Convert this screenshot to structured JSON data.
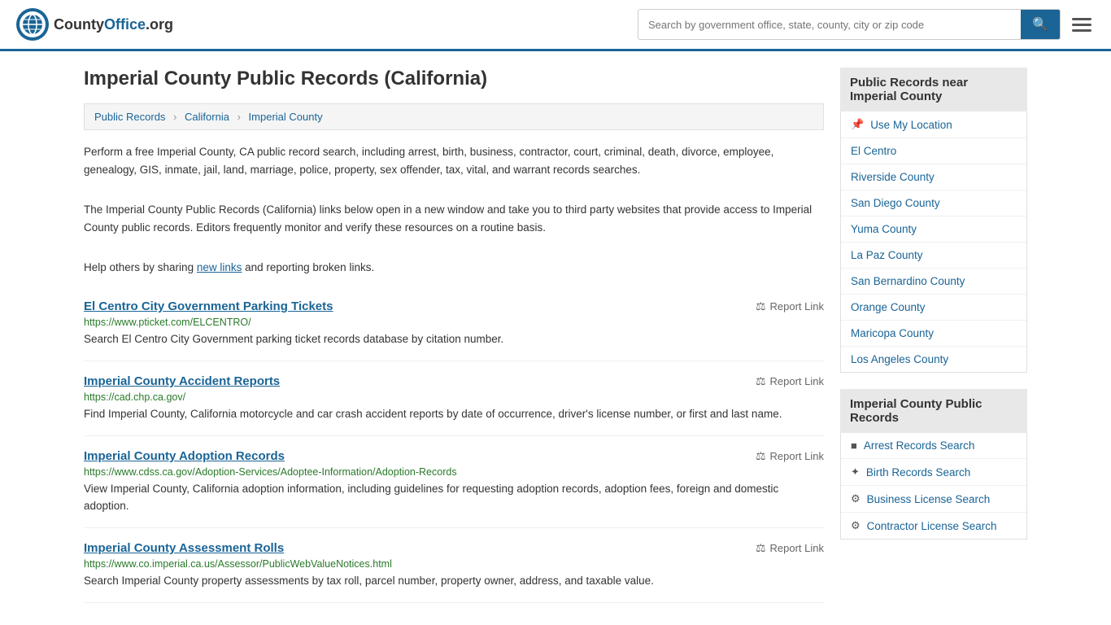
{
  "header": {
    "logo_text": "CountyOffice",
    "logo_suffix": ".org",
    "search_placeholder": "Search by government office, state, county, city or zip code",
    "search_value": ""
  },
  "page": {
    "title": "Imperial County Public Records (California)"
  },
  "breadcrumb": {
    "items": [
      {
        "label": "Public Records",
        "href": "#"
      },
      {
        "label": "California",
        "href": "#"
      },
      {
        "label": "Imperial County",
        "href": "#"
      }
    ]
  },
  "description": {
    "para1": "Perform a free Imperial County, CA public record search, including arrest, birth, business, contractor, court, criminal, death, divorce, employee, genealogy, GIS, inmate, jail, land, marriage, police, property, sex offender, tax, vital, and warrant records searches.",
    "para2": "The Imperial County Public Records (California) links below open in a new window and take you to third party websites that provide access to Imperial County public records. Editors frequently monitor and verify these resources on a routine basis.",
    "para3_pre": "Help others by sharing ",
    "para3_link": "new links",
    "para3_post": " and reporting broken links."
  },
  "records": [
    {
      "title": "El Centro City Government Parking Tickets",
      "url": "https://www.pticket.com/ELCENTRO/",
      "desc": "Search El Centro City Government parking ticket records database by citation number.",
      "report": "Report Link"
    },
    {
      "title": "Imperial County Accident Reports",
      "url": "https://cad.chp.ca.gov/",
      "desc": "Find Imperial County, California motorcycle and car crash accident reports by date of occurrence, driver's license number, or first and last name.",
      "report": "Report Link"
    },
    {
      "title": "Imperial County Adoption Records",
      "url": "https://www.cdss.ca.gov/Adoption-Services/Adoptee-Information/Adoption-Records",
      "desc": "View Imperial County, California adoption information, including guidelines for requesting adoption records, adoption fees, foreign and domestic adoption.",
      "report": "Report Link"
    },
    {
      "title": "Imperial County Assessment Rolls",
      "url": "https://www.co.imperial.ca.us/Assessor/PublicWebValueNotices.html",
      "desc": "Search Imperial County property assessments by tax roll, parcel number, property owner, address, and taxable value.",
      "report": "Report Link"
    }
  ],
  "sidebar": {
    "nearby_section": {
      "title": "Public Records near Imperial County",
      "items": [
        {
          "label": "Use My Location",
          "icon": "pin",
          "href": "#"
        },
        {
          "label": "El Centro",
          "icon": "",
          "href": "#"
        },
        {
          "label": "Riverside County",
          "icon": "",
          "href": "#"
        },
        {
          "label": "San Diego County",
          "icon": "",
          "href": "#"
        },
        {
          "label": "Yuma County",
          "icon": "",
          "href": "#"
        },
        {
          "label": "La Paz County",
          "icon": "",
          "href": "#"
        },
        {
          "label": "San Bernardino County",
          "icon": "",
          "href": "#"
        },
        {
          "label": "Orange County",
          "icon": "",
          "href": "#"
        },
        {
          "label": "Maricopa County",
          "icon": "",
          "href": "#"
        },
        {
          "label": "Los Angeles County",
          "icon": "",
          "href": "#"
        }
      ]
    },
    "records_section": {
      "title": "Imperial County Public Records",
      "items": [
        {
          "label": "Arrest Records Search",
          "icon": "square",
          "href": "#"
        },
        {
          "label": "Birth Records Search",
          "icon": "person",
          "href": "#"
        },
        {
          "label": "Business License Search",
          "icon": "gear",
          "href": "#"
        },
        {
          "label": "Contractor License Search",
          "icon": "gear",
          "href": "#"
        }
      ]
    }
  }
}
